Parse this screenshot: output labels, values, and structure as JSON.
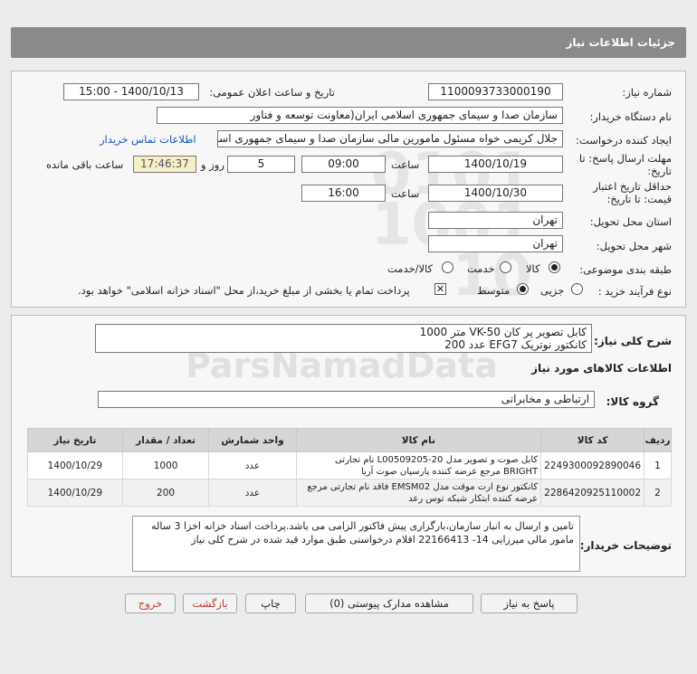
{
  "header": {
    "title": "جزئیات اطلاعات نیاز"
  },
  "form": {
    "need_number_label": "شماره نیاز:",
    "need_number": "1100093733000190",
    "announce_label": "تاریخ و ساعت اعلان عمومی:",
    "announce_value": "1400/10/13 - 15:00",
    "buyer_label": "نام دستگاه خریدار:",
    "buyer_value": "سازمان صدا و سیمای جمهوری اسلامی ایران(معاونت توسعه و فناور",
    "creator_label": "ایجاد کننده درخواست:",
    "creator_value": "جلال کریمی خواه مسئول مامورین مالی  سازمان صدا و سیمای جمهوری اسلا",
    "contact_link": "اطلاعات تماس خریدار",
    "deadline_label_1": "مهلت ارسال پاسخ: تا",
    "deadline_label_2": "تاریخ:",
    "deadline_date": "1400/10/19",
    "time_label": "ساعت",
    "deadline_time": "09:00",
    "days_value": "5",
    "days_label": "روز و",
    "remaining_time": "17:46:37",
    "remaining_label": "ساعت باقی مانده",
    "validity_label_1": "حداقل تاریخ اعتبار",
    "validity_label_2": "قیمت: تا تاریخ:",
    "validity_date": "1400/10/30",
    "validity_time": "16:00",
    "province_label": "استان محل تحویل:",
    "province_value": "تهران",
    "city_label": "شهر محل تحویل:",
    "city_value": "تهران",
    "category_label": "طبقه بندی موضوعی:",
    "category_options": [
      "کالا",
      "خدمت",
      "کالا/خدمت"
    ],
    "process_label": "نوع فرآیند خرید :",
    "process_options": [
      "جزیی",
      "متوسط"
    ],
    "payment_note": "پرداخت تمام یا بخشی از مبلغ خرید،از محل \"اسناد خزانه اسلامی\" خواهد بود."
  },
  "summary": {
    "label": "شرح کلی نیاز:",
    "line1": "کابل تصویر پر کان VK-50     متر 1000",
    "line2": "کانکتور نوتریک  EFG7    عدد 200"
  },
  "goods": {
    "section_title": "اطلاعات کالاهای مورد نیاز",
    "group_label": "گروه کالا:",
    "group_value": "ارتباطی و مخابراتی",
    "columns": [
      "ردیف",
      "کد کالا",
      "نام کالا",
      "واحد شمارش",
      "تعداد / مقدار",
      "تاریخ نیاز"
    ],
    "rows": [
      {
        "idx": "1",
        "code": "2249300092890046",
        "name": "کابل صوت و تصویر مدل L00509205-20 نام تجارتی BRIGHT مرجع عرضه کننده پارسیان صوت آریا",
        "unit": "عدد",
        "qty": "1000",
        "date": "1400/10/29"
      },
      {
        "idx": "2",
        "code": "2286420925110002",
        "name": "کانکتور نوع ارت موقت مدل EMSM02 فاقد نام تجارتی مرجع عرضه کننده ابتکار شبکه توس رعد",
        "unit": "عدد",
        "qty": "200",
        "date": "1400/10/29"
      }
    ]
  },
  "buyer_notes": {
    "label": "توضیحات خریدار:",
    "text": "تامین و ارسال به انبار سازمان،بارگزاری پیش فاکتور الزامی می باشد.پرداخت اسناد خزانه اخزا 3 ساله مامور مالی میرزایی 14-  22166413 اقلام درخواستی طبق موارد قید شده در شرح کلی نیاز"
  },
  "buttons": {
    "reply": "پاسخ به نیاز",
    "attachments": "مشاهده مدارک پیوستی (0)",
    "print": "چاپ",
    "back": "بازگشت",
    "exit": "خروج"
  }
}
